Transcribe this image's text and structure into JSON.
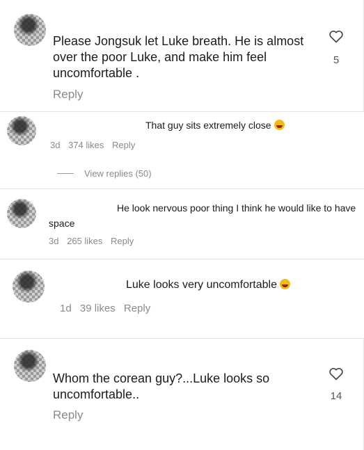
{
  "comments": [
    {
      "text": "Please Jongsuk let Luke breath.  He is almost over the poor Luke, and make him feel uncomfortable .",
      "reply": "Reply",
      "likes": "5"
    },
    {
      "text": "That guy sits extremely close",
      "meta": {
        "age": "3d",
        "likes": "374 likes",
        "reply": "Reply"
      },
      "view_replies": "View replies (50)"
    },
    {
      "text": "He look nervous poor thing I think he would like to have space",
      "meta": {
        "age": "3d",
        "likes": "265 likes",
        "reply": "Reply"
      }
    },
    {
      "text": "Luke looks very uncomfortable",
      "meta": {
        "age": "1d",
        "likes": "39 likes",
        "reply": "Reply"
      }
    },
    {
      "text": "Whom the corean guy?...Luke looks so uncomfortable..",
      "reply": "Reply",
      "likes": "14"
    }
  ],
  "icons": {
    "like": "heart-outline-icon",
    "emoji_laugh": "laughing-face-emoji",
    "emoji_woozy": "woozy-face-emoji"
  },
  "colors": {
    "text": "#1b1b1b",
    "muted": "#8a8a8a",
    "background": "#ffffff"
  }
}
